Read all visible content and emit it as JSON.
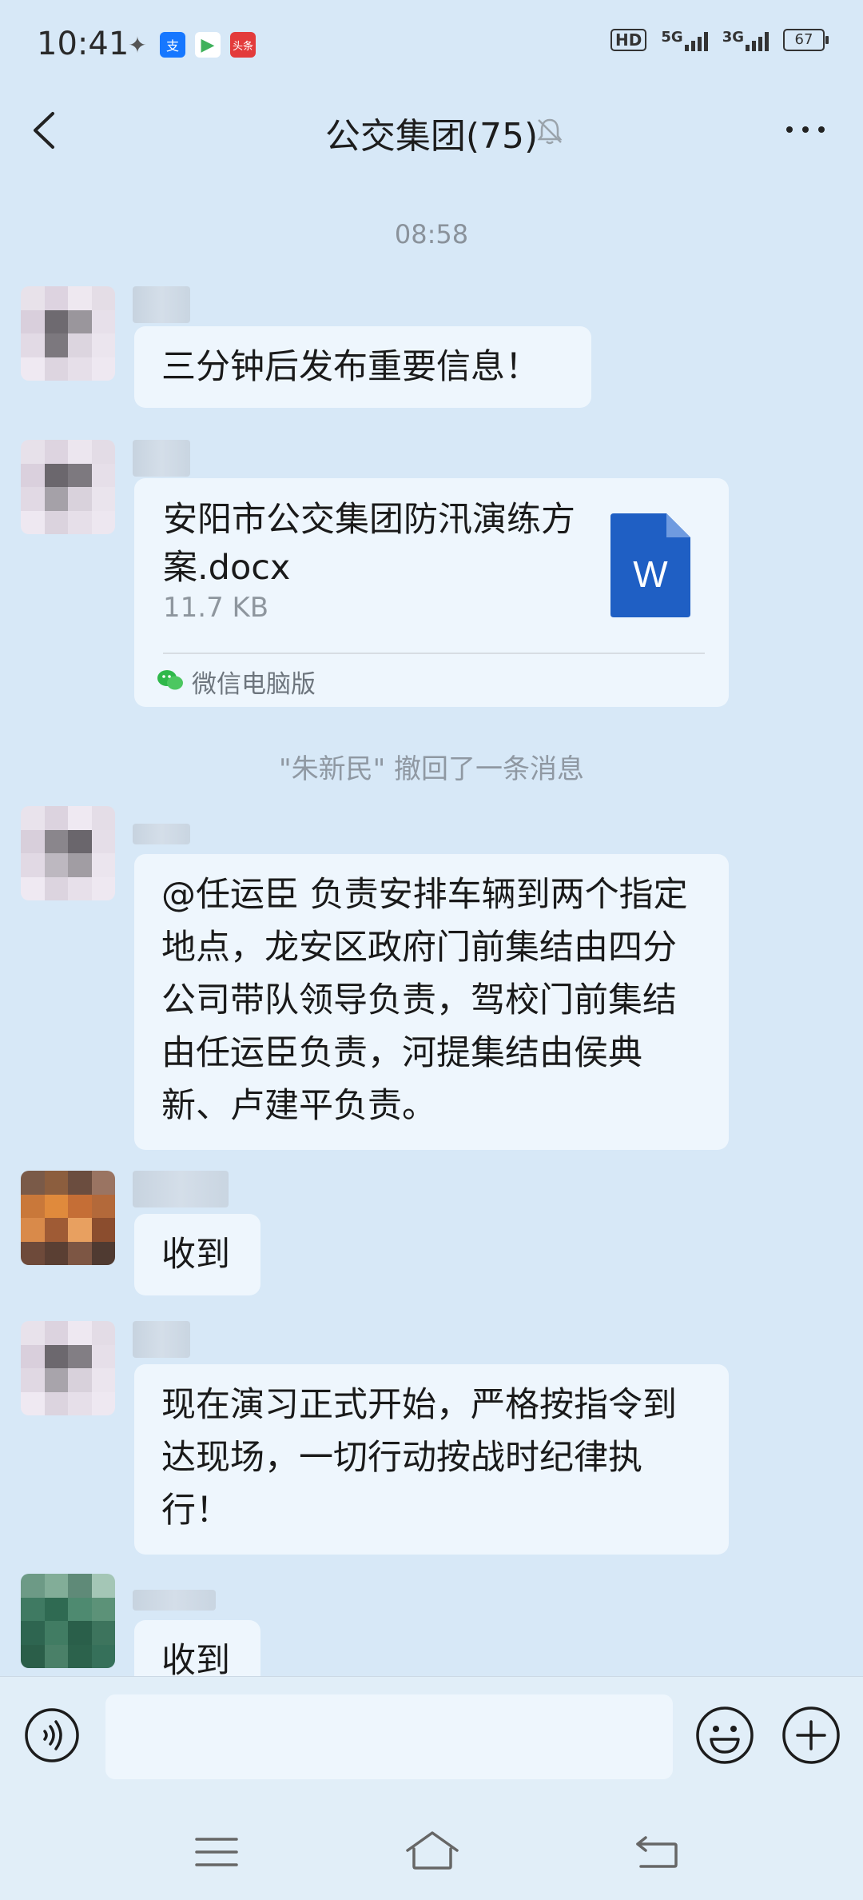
{
  "status_bar": {
    "time": "10:41",
    "apps": [
      {
        "name": "wechat-notification-icon",
        "glyph": "✦",
        "color": "#5b5b5b"
      },
      {
        "name": "alipay-notification-icon",
        "glyph": "支",
        "color": "#1677ff"
      },
      {
        "name": "video-app-notification-icon",
        "glyph": "▶",
        "color": "#3fb15b"
      },
      {
        "name": "toutiao-notification-icon",
        "glyph": "头条",
        "color": "#e33b3b"
      }
    ],
    "hd": "HD",
    "net1": "5G",
    "net2": "3G",
    "battery": "67"
  },
  "header": {
    "title": "公交集团(75)"
  },
  "timestamp": "08:58",
  "messages": [
    {
      "text": "三分钟后发布重要信息！"
    },
    {
      "file": {
        "name": "安阳市公交集团防汛演练方案.docx",
        "size": "11.7 KB",
        "source": "微信电脑版",
        "icon_letter": "W"
      }
    },
    {
      "text": "@任运臣  负责安排车辆到两个指定地点，龙安区政府门前集结由四分公司带队领导负责，驾校门前集结由任运臣负责，河提集结由侯典新、卢建平负责。"
    },
    {
      "text": "收到"
    },
    {
      "text": "现在演习正式开始，严格按指令到达现场，一切行动按战时纪律执行！"
    },
    {
      "text": "收到"
    }
  ],
  "system_message": "\"朱新民\" 撤回了一条消息",
  "colors": {
    "bg": "#d7e8f7",
    "bubble": "#eef6fd",
    "word_blue": "#1f5fc4"
  }
}
